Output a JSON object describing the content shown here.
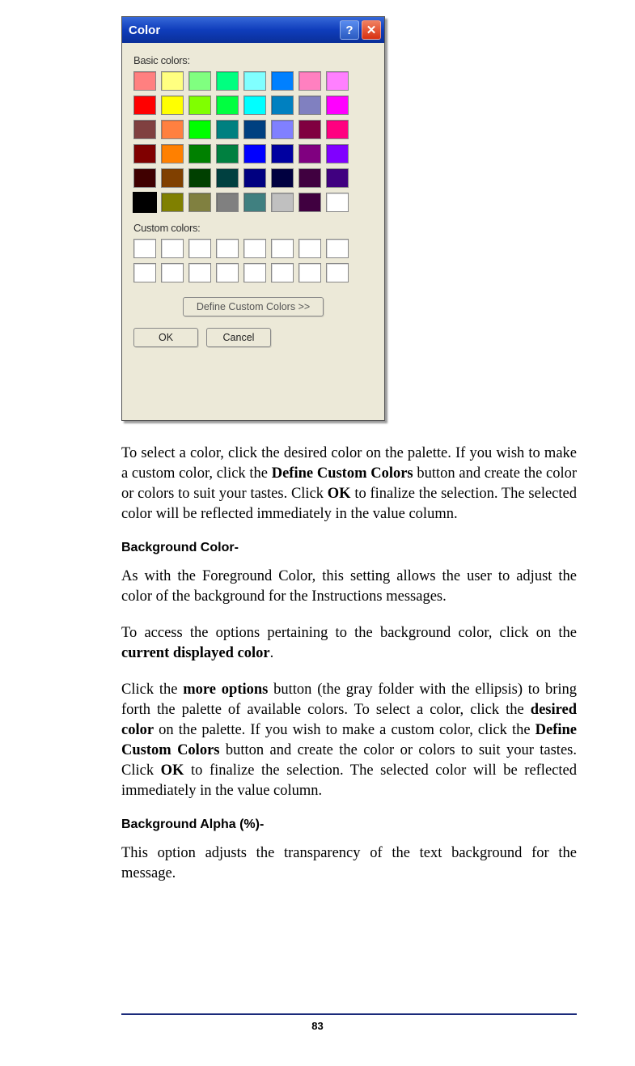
{
  "dialog": {
    "title": "Color",
    "help_glyph": "?",
    "close_glyph": "✕",
    "basic_label": "Basic colors:",
    "custom_label": "Custom colors:",
    "define_label": "Define Custom Colors >>",
    "ok_label": "OK",
    "cancel_label": "Cancel",
    "basic_colors": [
      "#ff8080",
      "#ffff80",
      "#80ff80",
      "#00ff80",
      "#80ffff",
      "#0080ff",
      "#ff80c0",
      "#ff80ff",
      "#ff0000",
      "#ffff00",
      "#80ff00",
      "#00ff40",
      "#00ffff",
      "#0080c0",
      "#8080c0",
      "#ff00ff",
      "#804040",
      "#ff8040",
      "#00ff00",
      "#008080",
      "#004080",
      "#8080ff",
      "#800040",
      "#ff0080",
      "#800000",
      "#ff8000",
      "#008000",
      "#008040",
      "#0000ff",
      "#0000a0",
      "#800080",
      "#8000ff",
      "#400000",
      "#804000",
      "#004000",
      "#004040",
      "#000080",
      "#000040",
      "#400040",
      "#400080",
      "#000000",
      "#808000",
      "#808040",
      "#808080",
      "#408080",
      "#c0c0c0",
      "#400040",
      "#ffffff"
    ],
    "selected_index": 40,
    "custom_slots": 16
  },
  "para1": {
    "t1": "To select a color, click the desired color on the palette.  If you wish to make a custom color, click the ",
    "b1": "Define Custom Colors",
    "t2": " button and create the color or colors to suit your tastes.  Click ",
    "b2": "OK",
    "t3": " to finalize the selection.  The selected color will be reflected immediately in the value column."
  },
  "heading1": "Background Color-",
  "para2": "As with the Foreground Color, this setting allows the user to adjust the color of the background for the Instructions messages.",
  "para3": {
    "t1": "To access the options pertaining to the background color, click on the ",
    "b1": "current displayed color",
    "t2": "."
  },
  "para4": {
    "t1": "Click the ",
    "b1": "more options",
    "t2": " button (the gray folder with the ellipsis) to bring forth the palette of available colors.  To select a color, click the ",
    "b2": "desired color",
    "t3": " on the palette.  If you wish to make a custom color, click the ",
    "b3": "Define Custom Colors",
    "t4": " button and create the color or colors to suit your tastes.  Click ",
    "b4": "OK",
    "t5": " to finalize the selection.  The selected color will be reflected immediately in the value column."
  },
  "heading2": "Background Alpha (%)-",
  "para5": "This option adjusts the transparency of the text background for the message.",
  "page_number": "83"
}
